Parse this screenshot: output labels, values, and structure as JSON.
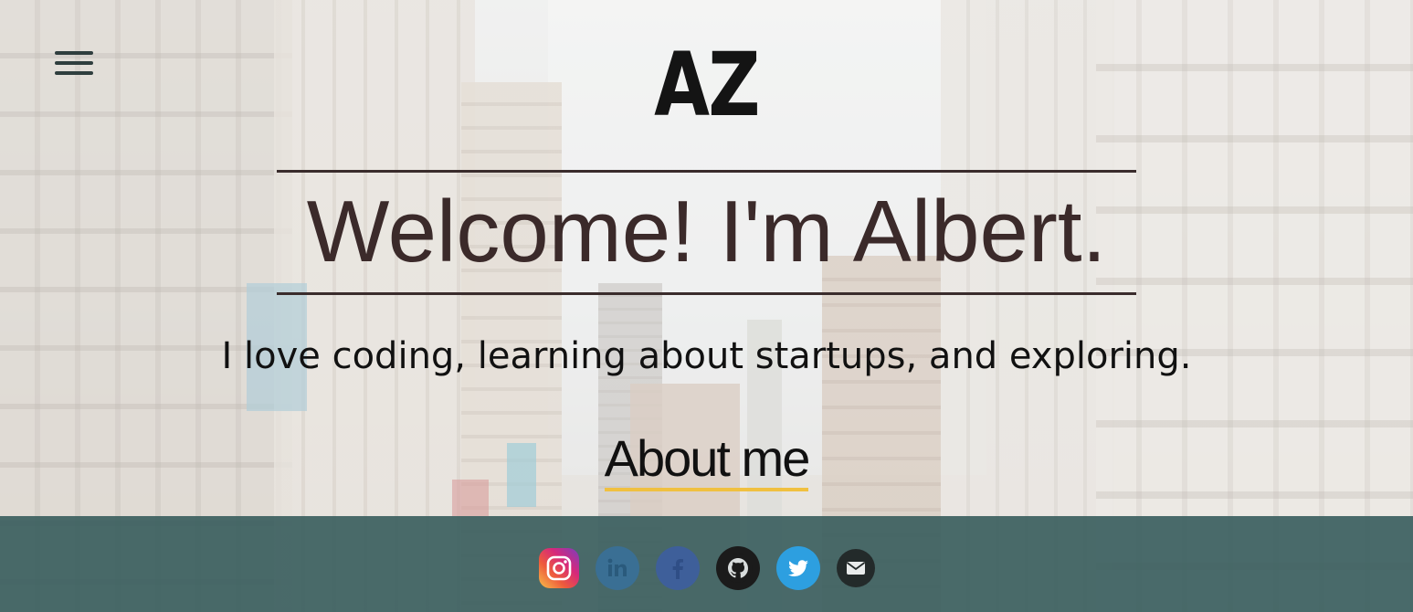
{
  "header": {
    "menu_icon": "hamburger-menu-icon",
    "logo_text": "AZ"
  },
  "hero": {
    "headline": "Welcome! I'm Albert.",
    "tagline": "I love coding, learning about startups, and exploring.",
    "about_link": "About me"
  },
  "colors": {
    "footer_bg": "#375c5c",
    "headline": "#3b2a2a",
    "about_underline": "#f0c040"
  },
  "footer": {
    "social": [
      {
        "name": "instagram",
        "icon": "instagram-icon"
      },
      {
        "name": "linkedin",
        "icon": "linkedin-icon"
      },
      {
        "name": "facebook",
        "icon": "facebook-icon"
      },
      {
        "name": "github",
        "icon": "github-icon"
      },
      {
        "name": "twitter",
        "icon": "twitter-icon"
      },
      {
        "name": "email",
        "icon": "email-icon"
      }
    ]
  }
}
